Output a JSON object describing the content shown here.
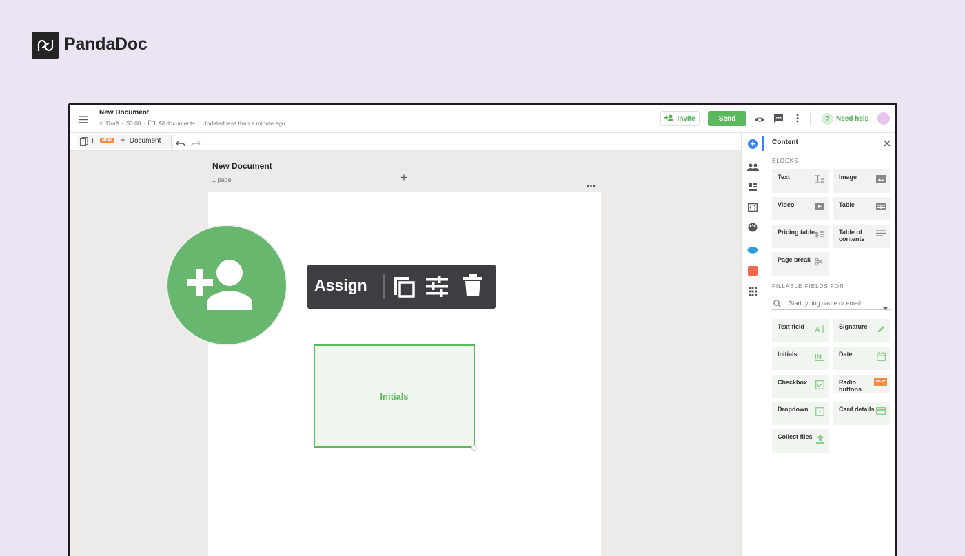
{
  "brand": {
    "name": "PandaDoc"
  },
  "header": {
    "menu_icon": "hamburger-icon",
    "doc_title": "New Document",
    "status": "Draft",
    "amount": "$0.00",
    "folder": "All documents",
    "updated": "Updated less than a minute ago",
    "invite_label": "Invite",
    "send_label": "Send",
    "help_label": "Need help",
    "colors": {
      "accent": "#5cb85c",
      "avatar": "#e6c4ec"
    }
  },
  "toolbar": {
    "page_count": "1",
    "new_badge": "NEW",
    "add_label": "Document"
  },
  "document": {
    "title": "New Document",
    "pages": "1 page"
  },
  "assign_toolbar": {
    "label": "Assign",
    "icons": [
      "add-person-icon",
      "duplicate-icon",
      "settings-sliders-icon",
      "trash-icon"
    ]
  },
  "initials_field": {
    "label": "Initials"
  },
  "panel": {
    "title": "Content",
    "blocks_heading": "BLOCKS",
    "blocks": [
      {
        "label": "Text",
        "icon": "text-icon"
      },
      {
        "label": "Image",
        "icon": "image-icon"
      },
      {
        "label": "Video",
        "icon": "video-icon"
      },
      {
        "label": "Table",
        "icon": "table-icon"
      },
      {
        "label": "Pricing table",
        "icon": "pricing-table-icon"
      },
      {
        "label": "Table of contents",
        "icon": "toc-icon"
      },
      {
        "label": "Page break",
        "icon": "scissors-icon"
      }
    ],
    "fields_heading": "FILLABLE FIELDS FOR",
    "recipient_placeholder": "Start typing name or email",
    "fields": [
      {
        "label": "Text field",
        "icon": "text-field-icon"
      },
      {
        "label": "Signature",
        "icon": "pen-icon"
      },
      {
        "label": "Initials",
        "icon": "initials-icon"
      },
      {
        "label": "Date",
        "icon": "calendar-icon"
      },
      {
        "label": "Checkbox",
        "icon": "checkbox-icon"
      },
      {
        "label": "Radio buttons",
        "icon": "radio-icon",
        "badge": "NEW"
      },
      {
        "label": "Dropdown",
        "icon": "dropdown-icon"
      },
      {
        "label": "Card details",
        "icon": "card-icon"
      },
      {
        "label": "Collect files",
        "icon": "upload-icon"
      }
    ]
  }
}
